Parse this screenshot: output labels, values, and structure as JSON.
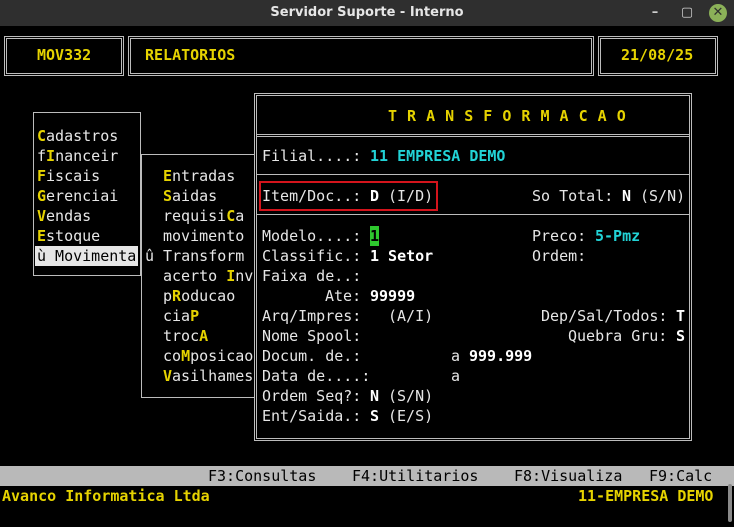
{
  "window": {
    "title": "Servidor Suporte - Interno",
    "minimize_glyph": "–",
    "maximize_glyph": "▢",
    "close_glyph": "✕"
  },
  "header": {
    "module": "MOV332",
    "section": "RELATORIOS",
    "date": "21/08/25"
  },
  "main_menu": {
    "items": [
      {
        "label": "Cadastros"
      },
      {
        "label": "fInanceir"
      },
      {
        "label": "Fiscais"
      },
      {
        "label": "Gerenciai"
      },
      {
        "label": "Vendas"
      },
      {
        "label": "Estoque"
      },
      {
        "label": "ù Movimenta"
      }
    ]
  },
  "sub_menu": {
    "items": [
      {
        "label": "Entradas"
      },
      {
        "label": "Saidas"
      },
      {
        "label": "requisiCa"
      },
      {
        "label": "movimento"
      },
      {
        "label": "û Transform"
      },
      {
        "label": "acerto Inv"
      },
      {
        "label": "pRoducao"
      },
      {
        "label": "ciaP"
      },
      {
        "label": "trocA"
      },
      {
        "label": "coMposicao"
      },
      {
        "label": "Vasilhames"
      }
    ]
  },
  "dialog": {
    "title": "T R A N S F O R M A C A O",
    "filial_label": "Filial....:",
    "filial_value": "11 EMPRESA DEMO",
    "item_doc_label": "Item/Doc..:",
    "item_doc_value": "D",
    "item_doc_hint": "(I/D)",
    "so_total_label": "So Total:",
    "so_total_value": "N",
    "so_total_hint": "(S/N)",
    "modelo_label": "Modelo....:",
    "modelo_value": "1",
    "preco_label": "Preco:",
    "preco_value": "5-Pmz",
    "classific_label": "Classific.:",
    "classific_value": "1 Setor",
    "ordem_label": "Ordem:",
    "faixa_label": "Faixa de..:",
    "ate_label": "Ate:",
    "ate_value": "99999",
    "arq_label": "Arq/Impres:",
    "arq_hint": "(A/I)",
    "dep_label": "Dep/Sal/Todos:",
    "dep_value": "T",
    "nome_spool_label": "Nome Spool:",
    "quebra_label": "Quebra Gru:",
    "quebra_value": "S",
    "docum_label": "Docum. de.:",
    "docum_a": "a",
    "docum_value": "999.999",
    "data_label": "Data de....:",
    "data_a": "a",
    "ordem_seq_label": "Ordem Seq?:",
    "ordem_seq_value": "N",
    "ordem_seq_hint": "(S/N)",
    "ent_saida_label": "Ent/Saida.:",
    "ent_saida_value": "S",
    "ent_saida_hint": "(E/S)"
  },
  "function_bar": {
    "f3": "F3:Consultas",
    "f4": "F4:Utilitarios",
    "f8": "F8:Visualiza",
    "f9": "F9:Calc"
  },
  "status_bar": {
    "company_left": "Avanco Informatica Ltda",
    "company_right": "11-EMPRESA DEMO"
  },
  "colors": {
    "accent_yellow": "#e6d300",
    "cyan": "#22d3d6",
    "highlight_red": "#d4141c",
    "cursor_green": "#2ec82e"
  }
}
